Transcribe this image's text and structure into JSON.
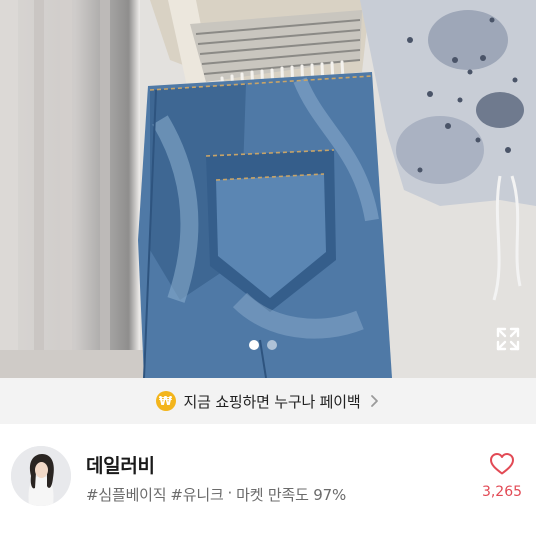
{
  "product_image": {
    "description_icon": "product-photo",
    "carousel": {
      "total": 2,
      "active_index": 0
    },
    "expand_icon": "expand-arrows-icon"
  },
  "banner": {
    "coin_symbol": "₩",
    "text": "지금 쇼핑하면 누구나 페이백",
    "chevron_icon": "chevron-right-icon"
  },
  "shop": {
    "name": "데일러비",
    "tags": [
      "#심플베이직",
      "#유니크"
    ],
    "separator": "·",
    "satisfaction": "마켓 만족도 97%",
    "like_count": "3,265",
    "like_icon": "heart-icon",
    "accent_color": "#e24a55"
  }
}
